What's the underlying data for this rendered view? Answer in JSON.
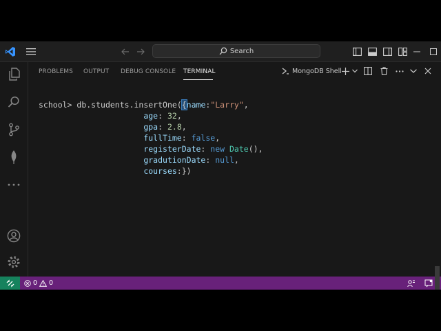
{
  "titlebar": {
    "search_label": "Search"
  },
  "activity_bar": {
    "items": [
      "explorer-icon",
      "search-icon",
      "source-control-icon",
      "mongodb-leaf-icon",
      "more-icon"
    ],
    "bottom_items": [
      "account-icon",
      "settings-gear-icon"
    ]
  },
  "panel": {
    "tabs": [
      {
        "label": "PROBLEMS",
        "active": false
      },
      {
        "label": "OUTPUT",
        "active": false
      },
      {
        "label": "DEBUG CONSOLE",
        "active": false
      },
      {
        "label": "TERMINAL",
        "active": true
      }
    ],
    "terminal_name": "MongoDB Shell"
  },
  "terminal": {
    "prompt": "school>",
    "command": "db.students.insertOne(",
    "lines": {
      "name_key": "name",
      "name_value": "\"Larry\"",
      "age_key": "age",
      "age_value": "32",
      "gpa_key": "gpa",
      "gpa_value": "2.8",
      "fulltime_key": "fullTime",
      "fulltime_value": "false",
      "register_key": "registerDate",
      "register_new": "new",
      "register_ctor": "Date",
      "register_tail": "(),",
      "grad_key": "gradutionDate",
      "grad_value": "null",
      "courses_key": "courses",
      "courses_tail": ":})"
    }
  },
  "statusbar": {
    "errors": "0",
    "warnings": "0"
  },
  "colors": {
    "statusbar": "#68217a",
    "remote": "#16825d",
    "accent": "#0078d4"
  }
}
